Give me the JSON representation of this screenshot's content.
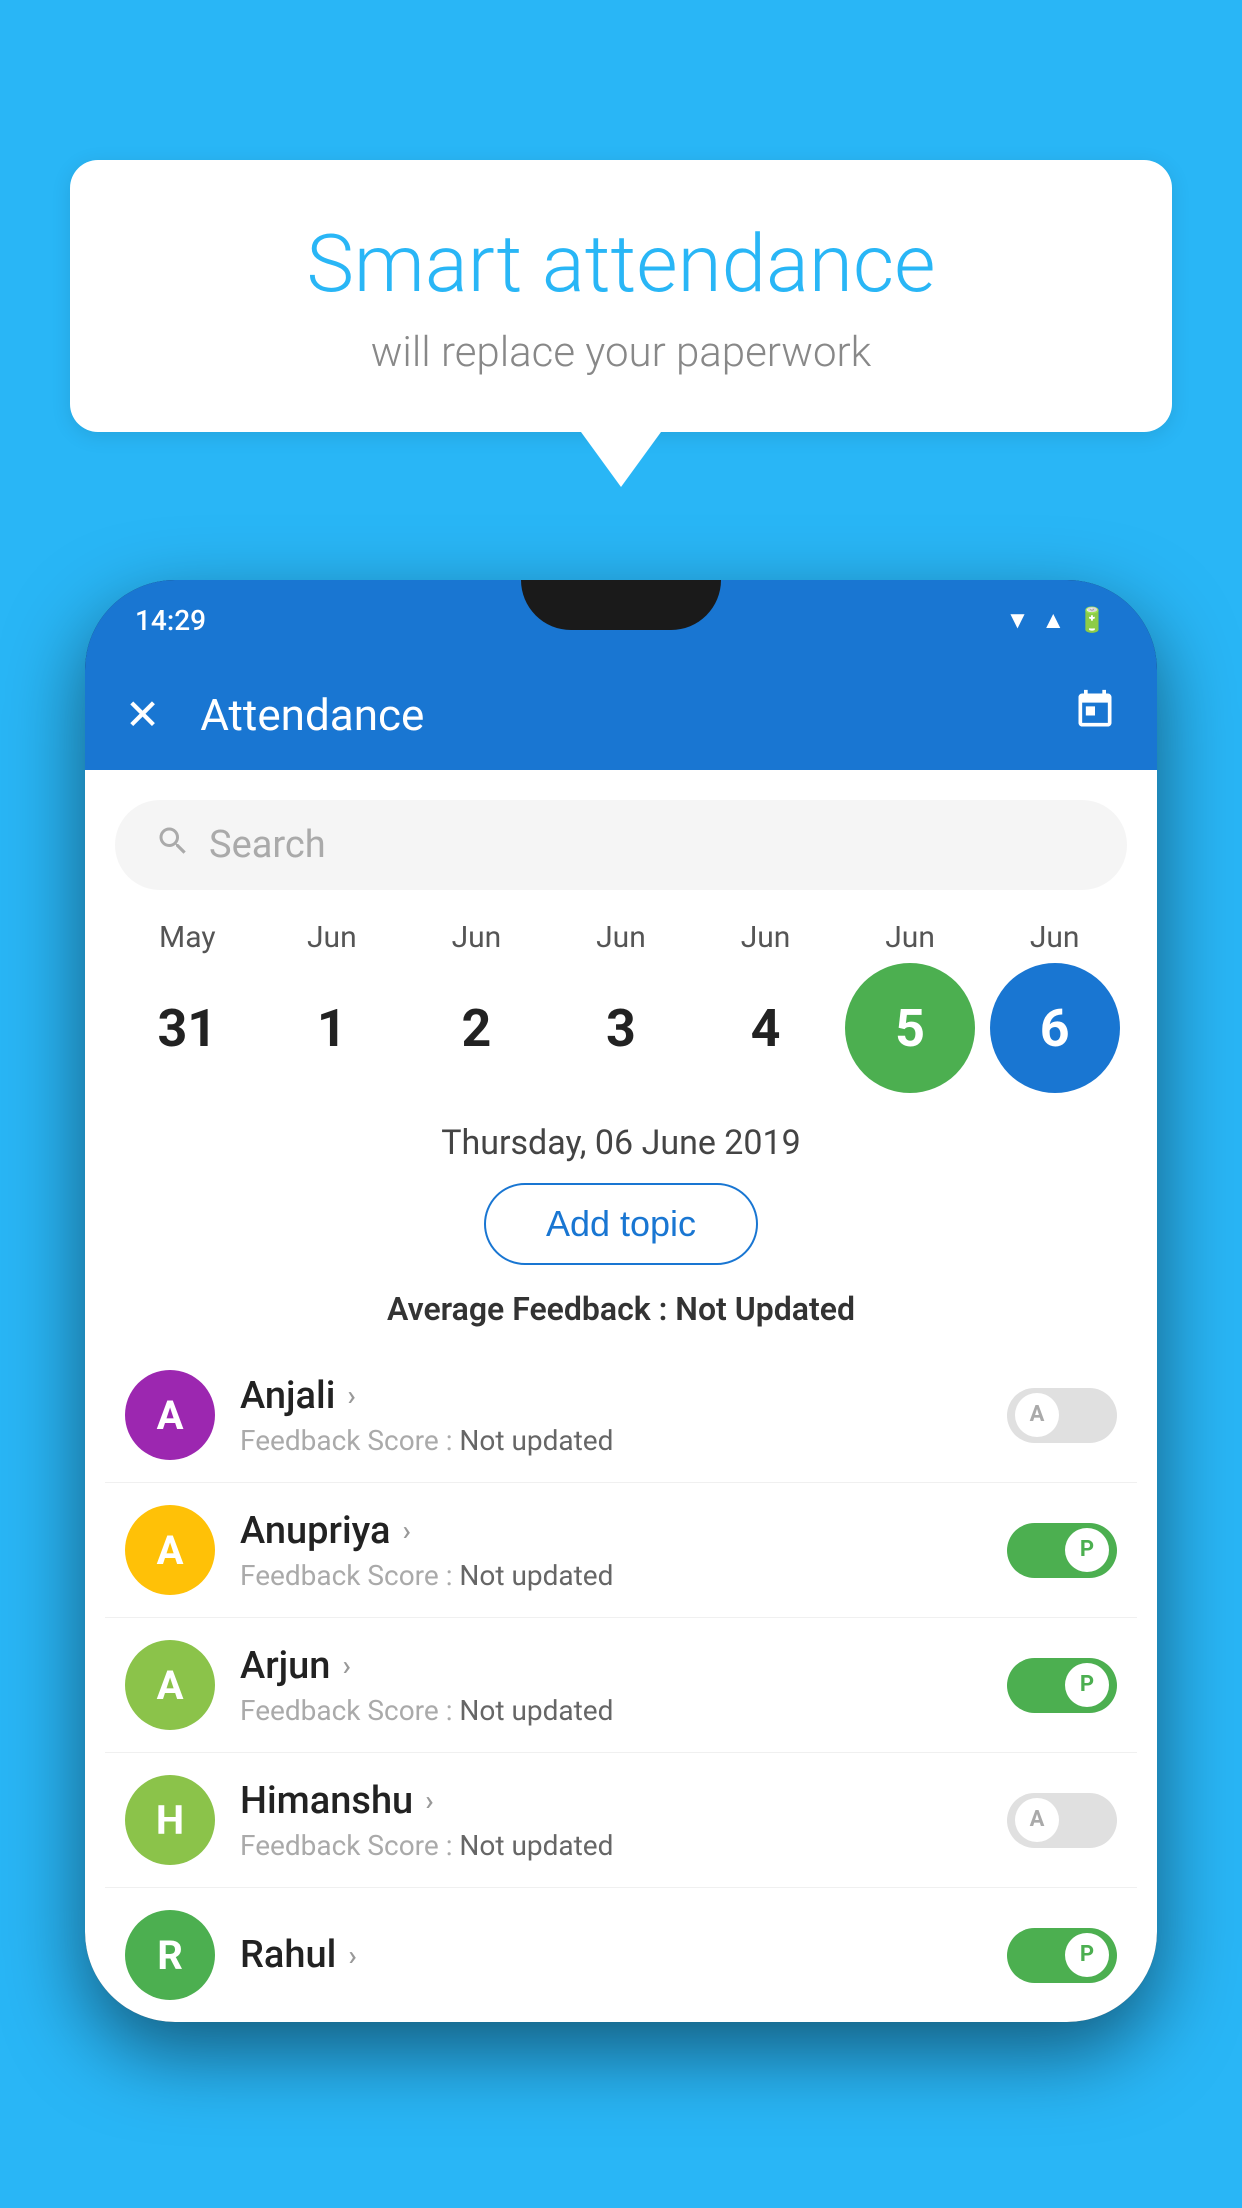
{
  "background_color": "#29B6F6",
  "speech_bubble": {
    "title": "Smart attendance",
    "subtitle": "will replace your paperwork"
  },
  "status_bar": {
    "time": "14:29"
  },
  "header": {
    "title": "Attendance",
    "close_label": "✕",
    "calendar_label": "📅"
  },
  "search": {
    "placeholder": "Search"
  },
  "calendar": {
    "months": [
      "May",
      "Jun",
      "Jun",
      "Jun",
      "Jun",
      "Jun",
      "Jun"
    ],
    "dates": [
      "31",
      "1",
      "2",
      "3",
      "4",
      "5",
      "6"
    ],
    "today_index": 5,
    "selected_index": 6
  },
  "date_display": "Thursday, 06 June 2019",
  "add_topic_label": "Add topic",
  "avg_feedback_label": "Average Feedback :",
  "avg_feedback_value": "Not Updated",
  "students": [
    {
      "name": "Anjali",
      "initial": "A",
      "avatar_color": "#9C27B0",
      "score_label": "Feedback Score :",
      "score_value": "Not updated",
      "attendance": "absent"
    },
    {
      "name": "Anupriya",
      "initial": "A",
      "avatar_color": "#FFC107",
      "score_label": "Feedback Score :",
      "score_value": "Not updated",
      "attendance": "present"
    },
    {
      "name": "Arjun",
      "initial": "A",
      "avatar_color": "#8BC34A",
      "score_label": "Feedback Score :",
      "score_value": "Not updated",
      "attendance": "present"
    },
    {
      "name": "Himanshu",
      "initial": "H",
      "avatar_color": "#8BC34A",
      "score_label": "Feedback Score :",
      "score_value": "Not updated",
      "attendance": "absent"
    }
  ]
}
